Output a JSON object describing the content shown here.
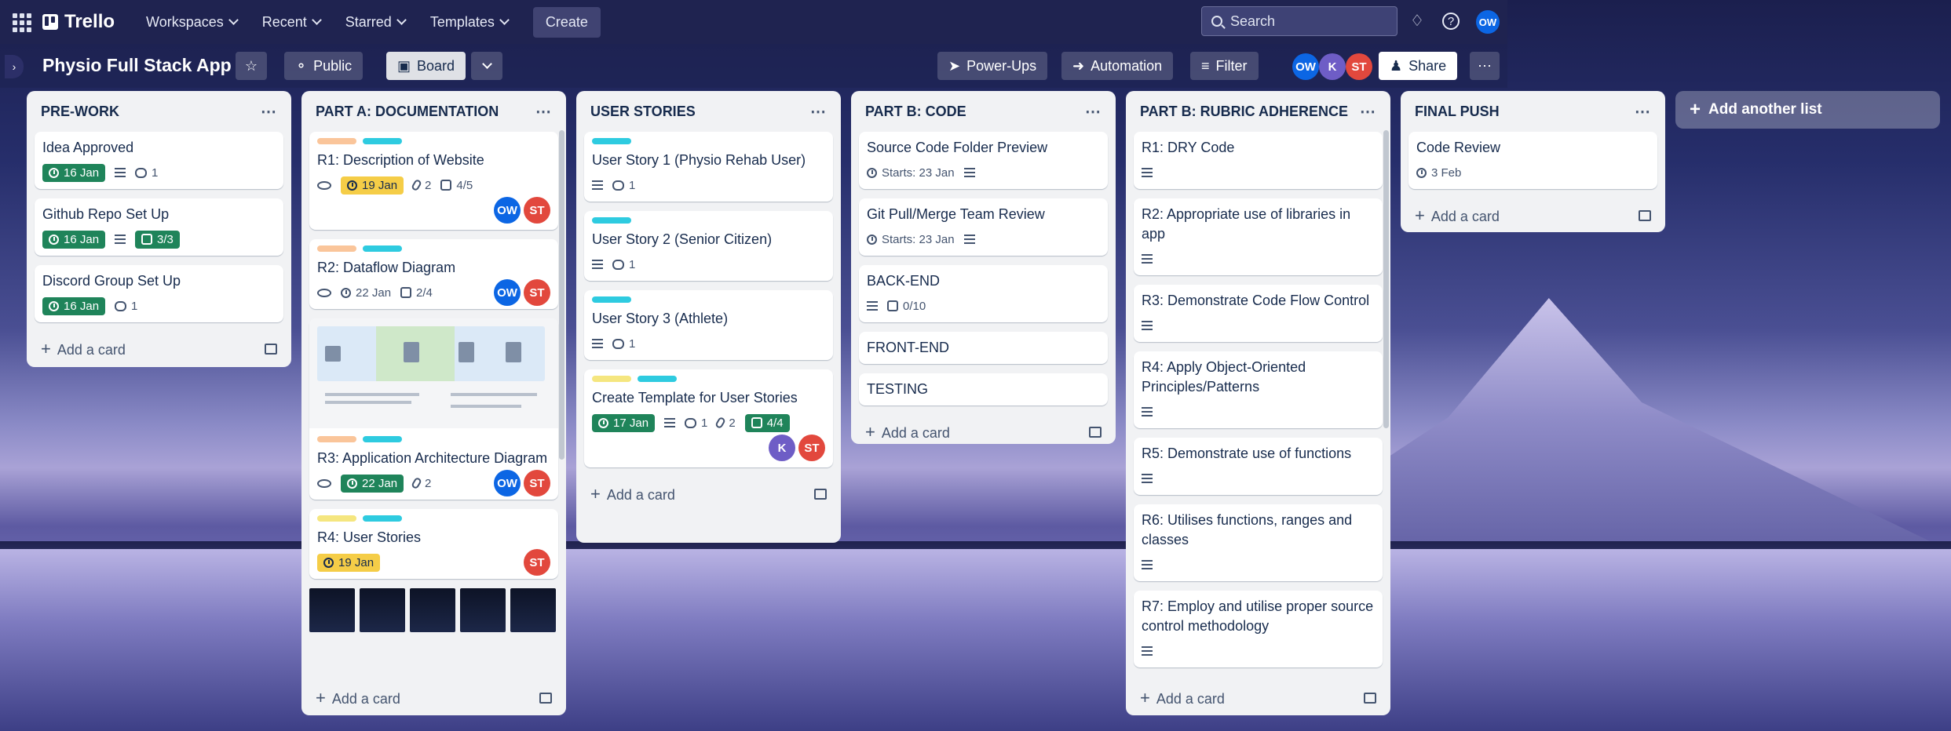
{
  "nav": {
    "brand": "Trello",
    "menus": [
      "Workspaces",
      "Recent",
      "Starred",
      "Templates"
    ],
    "create_label": "Create",
    "search_placeholder": "Search",
    "user_initials": "OW"
  },
  "board": {
    "title": "Physio Full Stack App",
    "visibility": "Public",
    "view": "Board",
    "powerups": "Power-Ups",
    "automation": "Automation",
    "filter": "Filter",
    "share": "Share",
    "members": [
      "OW",
      "K",
      "ST"
    ]
  },
  "colors": {
    "nav_bg": "#1f2350",
    "green": "#1f845a",
    "yellow": "#f5cd47",
    "orange_label": "#fac59a",
    "teal_label": "#2ecbe0",
    "yellow_label": "#f5e67f",
    "avatar_ow": "#0c66e4",
    "avatar_st": "#e2483d",
    "avatar_k": "#6e5dc6"
  },
  "lists": {
    "prework": {
      "title": "PRE-WORK",
      "cards": [
        {
          "title": "Idea Approved",
          "due": "16 Jan",
          "comments": "1"
        },
        {
          "title": "Github Repo Set Up",
          "due": "16 Jan",
          "checklist": "3/3"
        },
        {
          "title": "Discord Group Set Up",
          "due": "16 Jan",
          "comments": "1"
        }
      ],
      "add": "Add a card"
    },
    "parta": {
      "title": "PART A: DOCUMENTATION",
      "cards": [
        {
          "title": "R1: Description of Website",
          "due": "19 Jan",
          "attachments": "2",
          "checklist": "4/5"
        },
        {
          "title": "R2: Dataflow Diagram",
          "date": "22 Jan",
          "checklist": "2/4"
        },
        {
          "title": "R3: Application Architecture Diagram",
          "due": "22 Jan",
          "attachments": "2"
        },
        {
          "title": "R4: User Stories",
          "due": "19 Jan"
        }
      ],
      "add": "Add a card"
    },
    "stories": {
      "title": "USER STORIES",
      "cards": [
        {
          "title": "User Story 1 (Physio Rehab User)",
          "comments": "1"
        },
        {
          "title": "User Story 2 (Senior Citizen)",
          "comments": "1"
        },
        {
          "title": "User Story 3 (Athlete)",
          "comments": "1"
        },
        {
          "title": "Create Template for User Stories",
          "due": "17 Jan",
          "comments": "1",
          "attachments": "2",
          "checklist": "4/4"
        }
      ],
      "add": "Add a card"
    },
    "partb": {
      "title": "PART B: CODE",
      "cards": [
        {
          "title": "Source Code Folder Preview",
          "starts": "Starts: 23 Jan"
        },
        {
          "title": "Git Pull/Merge Team Review",
          "starts": "Starts: 23 Jan"
        },
        {
          "title": "BACK-END",
          "checklist": "0/10"
        },
        {
          "title": "FRONT-END"
        },
        {
          "title": "TESTING"
        }
      ],
      "add": "Add a card"
    },
    "rubric": {
      "title": "PART B: RUBRIC ADHERENCE",
      "cards": [
        {
          "title": "R1: DRY Code"
        },
        {
          "title": "R2: Appropriate use of libraries in app"
        },
        {
          "title": "R3: Demonstrate Code Flow Control"
        },
        {
          "title": "R4: Apply Object-Oriented Principles/Patterns"
        },
        {
          "title": "R5: Demonstrate use of functions"
        },
        {
          "title": "R6: Utilises functions, ranges and classes"
        },
        {
          "title": "R7: Employ and utilise proper source control methodology"
        }
      ],
      "add": "Add a card"
    },
    "final": {
      "title": "FINAL PUSH",
      "cards": [
        {
          "title": "Code Review",
          "date": "3 Feb"
        }
      ],
      "add": "Add a card"
    }
  },
  "add_list": "Add another list"
}
